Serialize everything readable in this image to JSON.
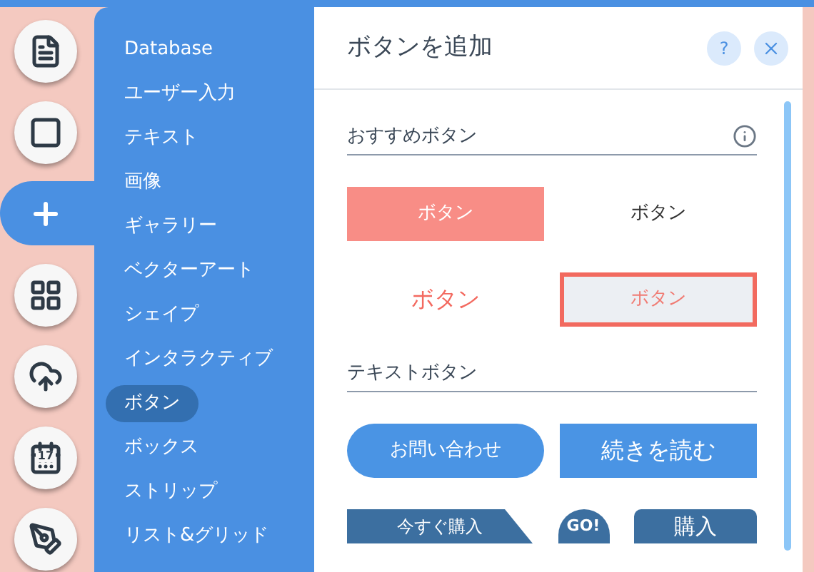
{
  "rail": [
    {
      "kind": "list",
      "selected": false
    },
    {
      "kind": "square",
      "selected": false
    },
    {
      "kind": "plus",
      "selected": true
    },
    {
      "kind": "apps",
      "selected": false
    },
    {
      "kind": "upload",
      "selected": false
    },
    {
      "kind": "calendar",
      "selected": false,
      "label": "17"
    },
    {
      "kind": "pen",
      "selected": false
    }
  ],
  "menu": [
    {
      "label": "Database",
      "selected": false
    },
    {
      "label": "ユーザー入力",
      "selected": false
    },
    {
      "label": "テキスト",
      "selected": false
    },
    {
      "label": "画像",
      "selected": false
    },
    {
      "label": "ギャラリー",
      "selected": false
    },
    {
      "label": "ベクターアート",
      "selected": false
    },
    {
      "label": "シェイプ",
      "selected": false
    },
    {
      "label": "インタラクティブ",
      "selected": false
    },
    {
      "label": "ボタン",
      "selected": true
    },
    {
      "label": "ボックス",
      "selected": false
    },
    {
      "label": "ストリップ",
      "selected": false
    },
    {
      "label": "リスト&グリッド",
      "selected": false
    }
  ],
  "panel": {
    "title": "ボタンを追加",
    "help": "?",
    "sections": [
      {
        "title": "おすすめボタン",
        "info": true,
        "buttons": [
          {
            "kind": "solid-coral",
            "label": "ボタン",
            "selected": false
          },
          {
            "kind": "plain",
            "label": "ボタン",
            "selected": false
          },
          {
            "kind": "text-coral",
            "label": "ボタン",
            "selected": false
          },
          {
            "kind": "gray",
            "label": "ボタン",
            "selected": true
          }
        ]
      },
      {
        "title": "テキストボタン",
        "info": false,
        "buttons": [
          {
            "kind": "pill",
            "label": "お問い合わせ",
            "selected": false
          },
          {
            "kind": "block",
            "label": "続きを読む",
            "selected": false
          },
          {
            "kind": "arrow",
            "label": "今すぐ購入",
            "selected": false
          },
          {
            "kind": "circle",
            "label": "GO!",
            "selected": false
          },
          {
            "kind": "rounded",
            "label": "購入",
            "selected": false
          }
        ]
      }
    ]
  }
}
